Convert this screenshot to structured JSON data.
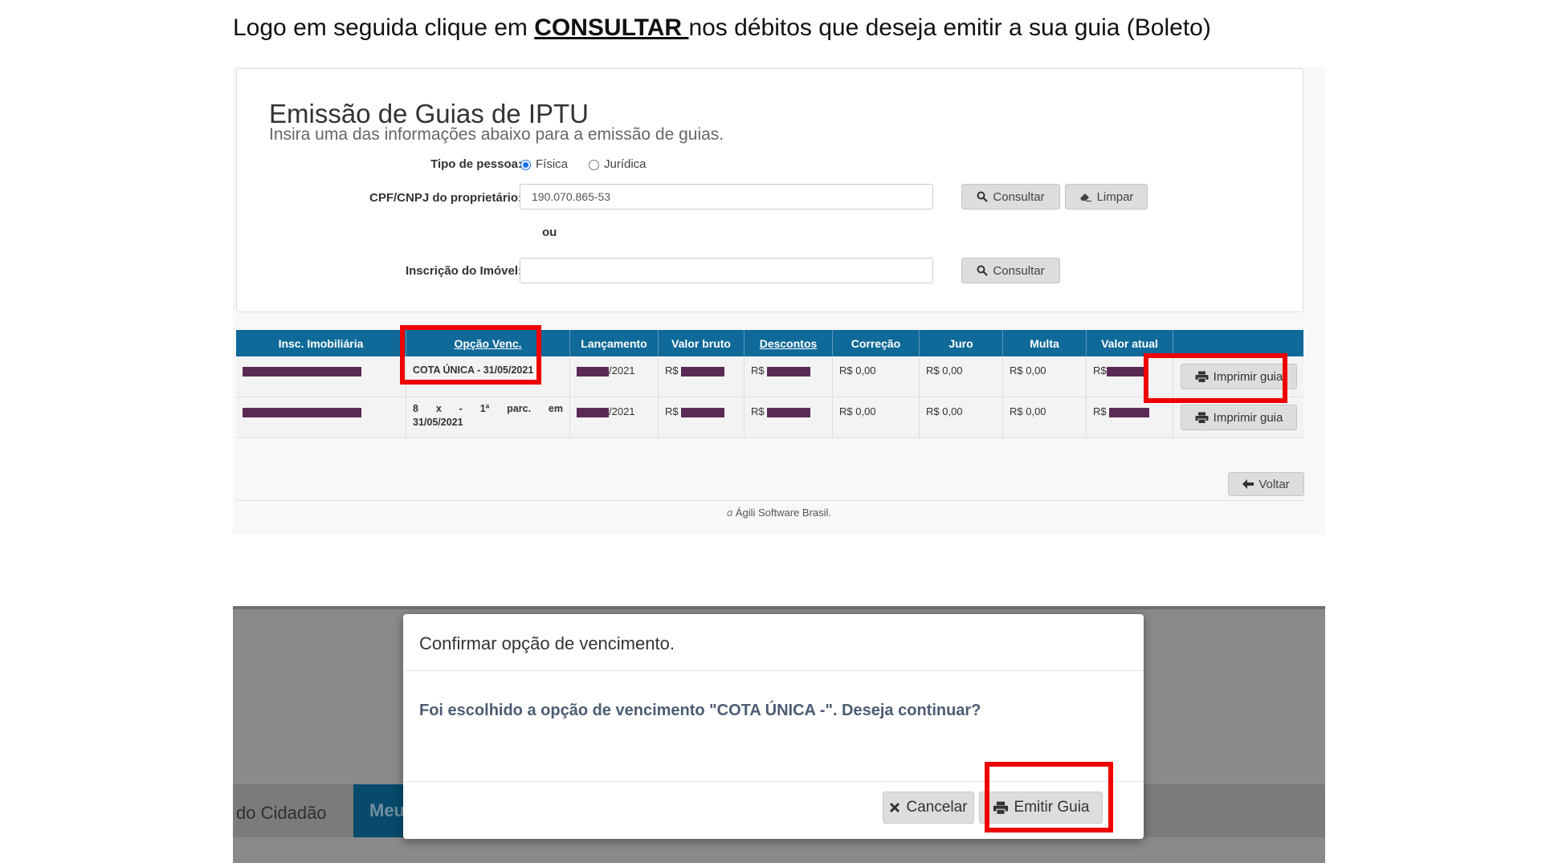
{
  "instruction": {
    "prefix": "Logo em seguida clique em ",
    "emphasis": "CONSULTAR ",
    "suffix": "nos débitos que deseja emitir a sua guia (Boleto)"
  },
  "form": {
    "title": "Emissão de Guias de IPTU",
    "subtitle": "Insira uma das informações abaixo para a emissão de guias.",
    "person_type_label": "Tipo de pessoa:",
    "person_type_options": [
      "Física",
      "Jurídica"
    ],
    "person_type_selected": "Física",
    "cpf_label": "CPF/CNPJ do proprietário:",
    "cpf_value": "190.070.865-53",
    "consult_label": "Consultar",
    "clear_label": "Limpar",
    "or_label": "ou",
    "inscricao_label": "Inscrição do Imóvel:",
    "inscricao_value": ""
  },
  "table": {
    "headers": [
      "Insc. Imobiliária",
      "Opção Venc.",
      "Lançamento",
      "Valor bruto",
      "Descontos",
      "Correção",
      "Juro",
      "Multa",
      "Valor atual",
      ""
    ],
    "rows": [
      {
        "opcao": "COTA ÚNICA - 31/05/2021",
        "lancamento": "/2021",
        "valor_bruto_prefix": "R$",
        "descontos_prefix": "R$",
        "correcao": "R$ 0,00",
        "juro": "R$ 0,00",
        "multa": "R$ 0,00",
        "valor_atual_prefix": "R$",
        "action": "Imprimir guia"
      },
      {
        "opcao": "8 x - 1ª parc. em 31/05/2021",
        "lancamento": "/2021",
        "valor_bruto_prefix": "R$",
        "descontos_prefix": "R$",
        "correcao": "R$ 0,00",
        "juro": "R$ 0,00",
        "multa": "R$ 0,00",
        "valor_atual_prefix": "R$",
        "action": "Imprimir guia"
      }
    ]
  },
  "back_label": "Voltar",
  "footer": "Ágili Software Brasil.",
  "bottom": {
    "nav_left": "do Cidadão",
    "nav_active": "Meu",
    "modal_title": "Confirmar opção de vencimento.",
    "modal_body": "Foi escolhido a opção de vencimento \"COTA ÚNICA -\". Deseja continuar?",
    "cancel_label": "Cancelar",
    "emit_label": "Emitir Guia"
  },
  "colors": {
    "table_header": "#0f6a99",
    "highlight": "#ee0000",
    "redaction": "#5a2a55",
    "modal_text": "#4d5c73"
  },
  "icons": [
    "search-icon",
    "eraser-icon",
    "printer-icon",
    "arrow-left-icon",
    "close-icon"
  ]
}
